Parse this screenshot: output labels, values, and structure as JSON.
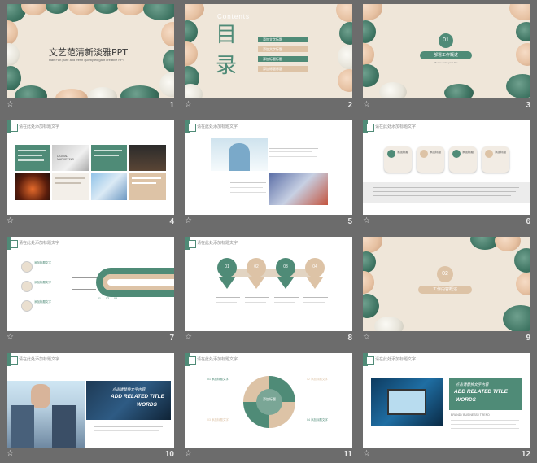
{
  "thumbnails": [
    {
      "num": "1",
      "title": "文艺范清新淡雅PPT",
      "subtitle": "Han Fan pure and fresh quietly elegant creative PPT"
    },
    {
      "num": "2",
      "contents_en": "Contents",
      "contents_cn_1": "目",
      "contents_cn_2": "录",
      "items": [
        "添加文字标题",
        "添加文字标题",
        "添加标题标题",
        "添加标题标题"
      ]
    },
    {
      "num": "3",
      "section_num": "01",
      "section_title": "部署工作概述",
      "section_sub": "Please enter your title"
    },
    {
      "num": "4",
      "header": "请在此处添加标题文字",
      "tile_text": "DIGITAL MARKETING"
    },
    {
      "num": "5",
      "header": "请在此处添加标题文字"
    },
    {
      "num": "6",
      "header": "请在此处添加标题文字",
      "steps": [
        "添加标题",
        "添加标题",
        "添加标题",
        "添加标题"
      ]
    },
    {
      "num": "7",
      "header": "请在此处添加标题文字",
      "items": [
        "添加标题文字",
        "添加标题文字",
        "添加标题文字"
      ],
      "pipe_labels": [
        "01",
        "02",
        "03"
      ]
    },
    {
      "num": "8",
      "header": "请在此处添加标题文字",
      "steps": [
        "01",
        "02",
        "03",
        "04"
      ]
    },
    {
      "num": "9",
      "section_num": "02",
      "section_title": "工作内容概述"
    },
    {
      "num": "10",
      "header": "请在此处添加标题文字",
      "banner_cn": "点击请替换文字内容",
      "banner_en_1": "ADD RELATED TITLE",
      "banner_en_2": "WORDS"
    },
    {
      "num": "11",
      "header": "请在此处添加标题文字",
      "center_text": "添加标题",
      "items": [
        "01 添加标题文字",
        "02 添加标题文字",
        "03 添加标题文字",
        "04 添加标题文字"
      ]
    },
    {
      "num": "12",
      "header": "请在此处添加标题文字",
      "banner_cn": "点击请替换文字内容",
      "banner_en_1": "ADD RELATED TITLE",
      "banner_en_2": "WORDS",
      "caption": "BRAND / BUSINESS / TREND"
    }
  ],
  "colors": {
    "accent": "#4f8b77",
    "beige": "#ddc3a6",
    "background": "#6c6c6c",
    "selection": "#e9a23b"
  },
  "icons": {
    "slide_footer": "star-icon"
  }
}
